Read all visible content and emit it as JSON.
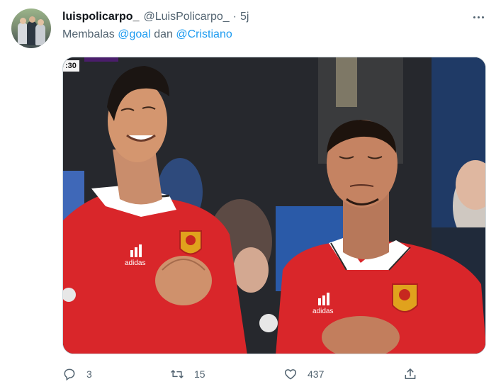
{
  "tweet": {
    "display_name": "luispolicarpo_",
    "handle": "@LuisPolicarpo_",
    "separator": "·",
    "time": "5j",
    "reply_prefix": "Membalas",
    "mention_1": "@goal",
    "conjunction": "dan",
    "mention_2": "@Cristiano"
  },
  "media": {
    "scoreboard_time": ":30",
    "jersey_sponsor": "adidas"
  },
  "actions": {
    "reply_count": "3",
    "retweet_count": "15",
    "like_count": "437"
  },
  "icons": {
    "more": "more-horizontal-icon",
    "reply": "reply-icon",
    "retweet": "retweet-icon",
    "like": "heart-icon",
    "share": "share-icon"
  },
  "colors": {
    "accent": "#1d9bf0",
    "text_secondary": "#536471",
    "jersey_red": "#d9262a"
  }
}
